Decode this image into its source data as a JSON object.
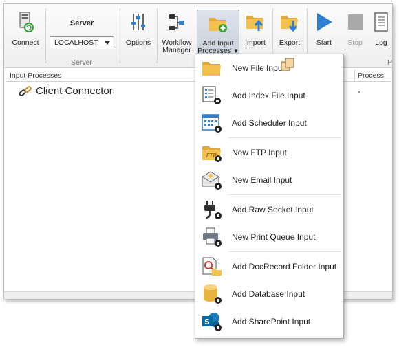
{
  "ribbon": {
    "connect_label": "Connect",
    "server_title": "Server",
    "server_value": "LOCALHOST",
    "options_label": "Options",
    "workflow_label_1": "Workflow",
    "workflow_label_2": "Manager",
    "add_input_label_1": "Add Input",
    "add_input_label_2": "Processes",
    "import_label": "Import",
    "export_label": "Export",
    "start_label": "Start",
    "stop_label": "Stop",
    "log_label": "Log",
    "group_server": "Server",
    "group_partial": "P"
  },
  "table": {
    "col_input_processes": "Input Processes",
    "col_process": "Process",
    "rows": [
      {
        "name": "Client Connector",
        "process": "-"
      }
    ]
  },
  "menu": {
    "items": [
      {
        "label": "New File Input",
        "icon": "folder-icon"
      },
      {
        "label": "Add Index File Input",
        "icon": "index-list-icon"
      },
      {
        "label": "Add Scheduler Input",
        "icon": "calendar-icon"
      },
      {
        "label": "New FTP Input",
        "icon": "ftp-folder-icon"
      },
      {
        "label": "New Email Input",
        "icon": "envelope-icon"
      },
      {
        "label": "Add Raw Socket Input",
        "icon": "plug-icon"
      },
      {
        "label": "New Print Queue Input",
        "icon": "printer-icon"
      },
      {
        "label": "Add DocRecord Folder Input",
        "icon": "docrecord-folder-icon"
      },
      {
        "label": "Add Database Input",
        "icon": "database-icon"
      },
      {
        "label": "Add SharePoint Input",
        "icon": "sharepoint-icon"
      }
    ]
  },
  "colors": {
    "accent_blue": "#2e7fd0",
    "folder_yellow": "#f2c14e",
    "disabled_gray": "#9a9a9a"
  }
}
